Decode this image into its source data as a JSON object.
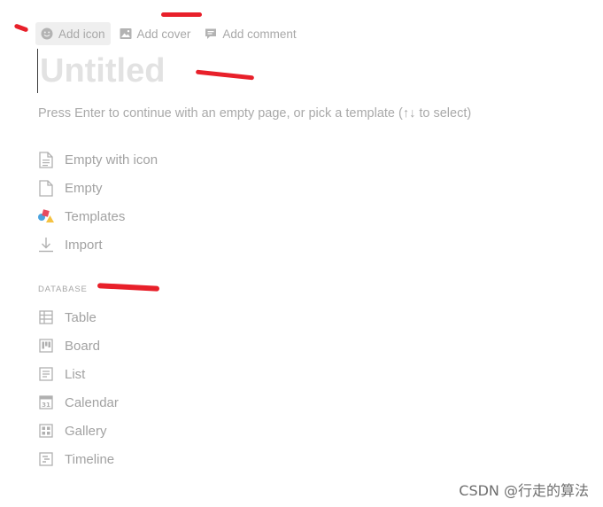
{
  "toolbar": {
    "add_icon": "Add icon",
    "add_cover": "Add cover",
    "add_comment": "Add comment"
  },
  "title": {
    "placeholder": "Untitled"
  },
  "hint": "Press Enter to continue with an empty page, or pick a template (↑↓ to select)",
  "options": [
    {
      "label": "Empty with icon",
      "icon": "page-with-lines-icon"
    },
    {
      "label": "Empty",
      "icon": "blank-page-icon"
    },
    {
      "label": "Templates",
      "icon": "templates-shapes-icon"
    },
    {
      "label": "Import",
      "icon": "import-arrow-icon"
    }
  ],
  "database": {
    "label": "DATABASE",
    "items": [
      {
        "label": "Table",
        "icon": "table-icon"
      },
      {
        "label": "Board",
        "icon": "board-icon"
      },
      {
        "label": "List",
        "icon": "list-icon"
      },
      {
        "label": "Calendar",
        "icon": "calendar-icon"
      },
      {
        "label": "Gallery",
        "icon": "gallery-icon"
      },
      {
        "label": "Timeline",
        "icon": "timeline-icon"
      }
    ]
  },
  "watermark": "CSDN @行走的算法",
  "colors": {
    "annotation": "#e8202a",
    "muted_text": "#a2a2a2",
    "icon": "#b0b0b0"
  }
}
